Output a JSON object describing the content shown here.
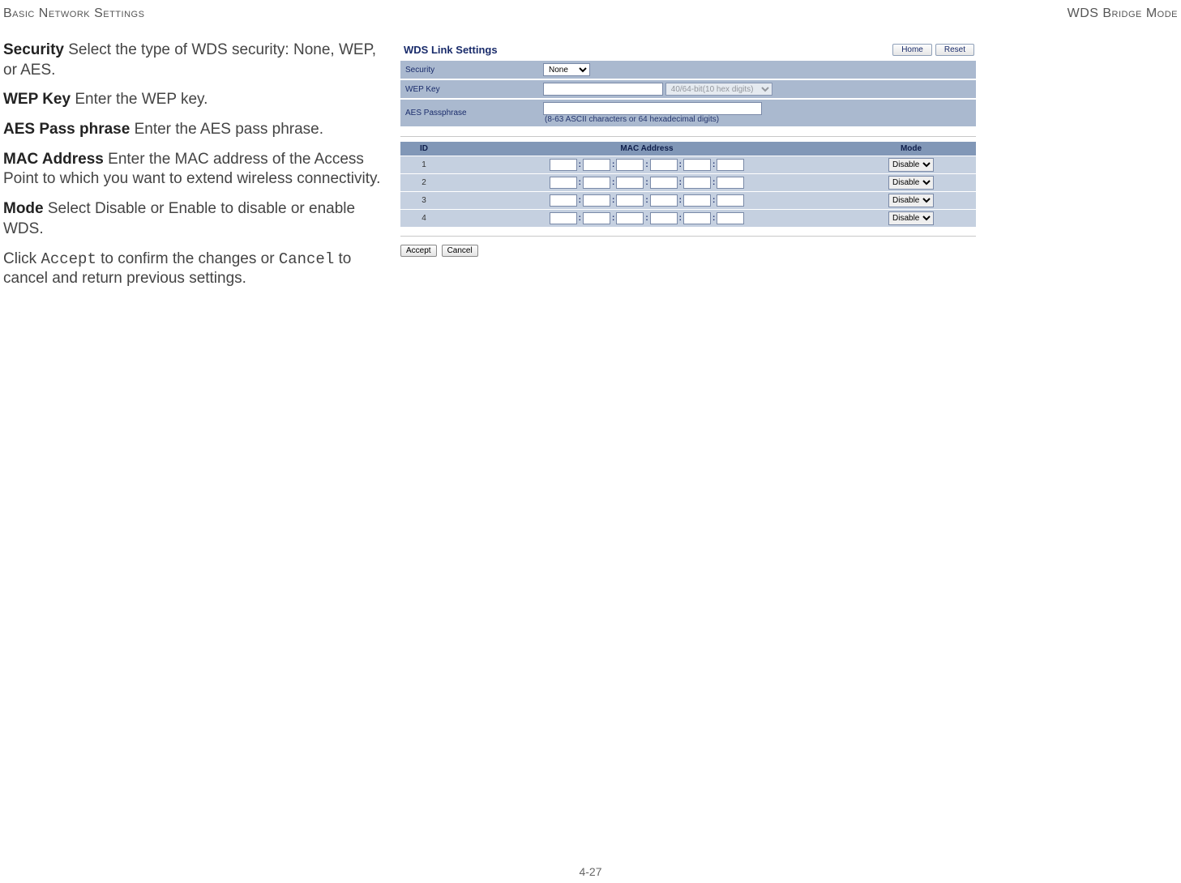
{
  "header": {
    "left": "Basic Network Settings",
    "right": "WDS Bridge Mode"
  },
  "descriptions": {
    "security_term": "Security",
    "security_text": "  Select the type of WDS security: None, WEP, or AES.",
    "wep_term": "WEP Key",
    "wep_text": "  Enter the WEP key.",
    "aes_term": "AES Pass phrase",
    "aes_text": "  Enter the AES pass phrase.",
    "mac_term": "MAC Address",
    "mac_text": "  Enter the MAC address of the Access Point to which you want to extend wireless connectivity.",
    "mode_term": "Mode",
    "mode_text": "  Select Disable or Enable to disable or enable WDS.",
    "click_text_a": "Click ",
    "accept_mono": "Accept",
    "click_text_b": " to confirm the changes or ",
    "cancel_mono": "Cancel",
    "click_text_c": " to cancel and return previous settings."
  },
  "panel": {
    "title": "WDS Link Settings",
    "home_btn": "Home",
    "reset_btn": "Reset",
    "security_label": "Security",
    "security_value": "None",
    "wep_label": "WEP Key",
    "wep_value": "",
    "wep_select": "40/64-bit(10 hex digits)",
    "aes_label": "AES Passphrase",
    "aes_value": "",
    "aes_hint": "(8-63 ASCII characters or 64 hexadecimal digits)"
  },
  "mac_table": {
    "headers": {
      "id": "ID",
      "mac": "MAC Address",
      "mode": "Mode"
    },
    "rows": [
      {
        "id": "1",
        "mode": "Disable"
      },
      {
        "id": "2",
        "mode": "Disable"
      },
      {
        "id": "3",
        "mode": "Disable"
      },
      {
        "id": "4",
        "mode": "Disable"
      }
    ]
  },
  "actions": {
    "accept": "Accept",
    "cancel": "Cancel"
  },
  "page_number": "4-27"
}
